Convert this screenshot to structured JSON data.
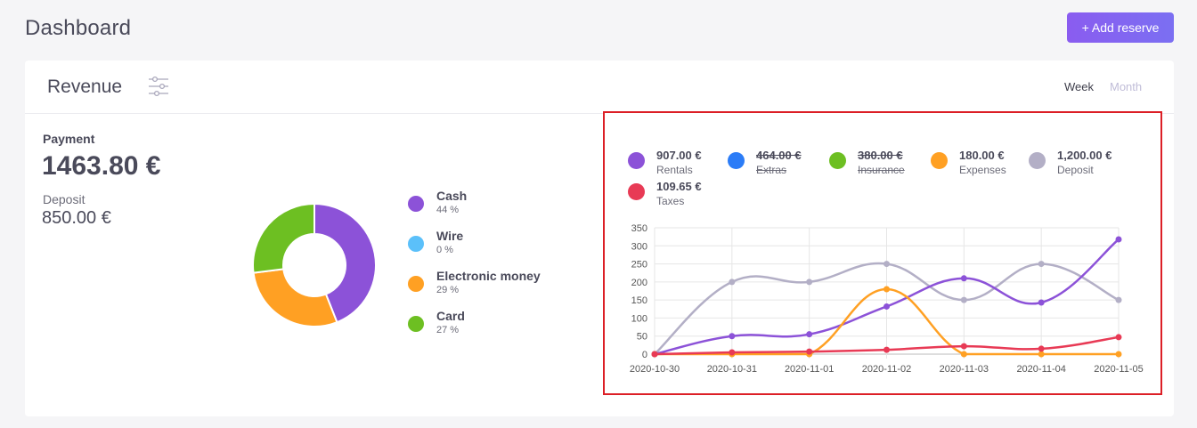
{
  "header": {
    "title": "Dashboard",
    "add_button": "+ Add reserve"
  },
  "revenue": {
    "title": "Revenue",
    "filter_icon": "sliders-icon",
    "periods": {
      "week": "Week",
      "month": "Month",
      "active": "Week"
    },
    "payment_label": "Payment",
    "payment_amount": "1463.80 €",
    "deposit_label": "Deposit",
    "deposit_amount": "850.00 €"
  },
  "payment_methods": {
    "items": [
      {
        "name": "Cash",
        "pct": "44 %",
        "value": 44,
        "color": "#8c52d8"
      },
      {
        "name": "Wire",
        "pct": "0 %",
        "value": 0,
        "color": "#5bc0fa"
      },
      {
        "name": "Electronic money",
        "pct": "29 %",
        "value": 29,
        "color": "#ffa023"
      },
      {
        "name": "Card",
        "pct": "27 %",
        "value": 27,
        "color": "#6dbf22"
      }
    ]
  },
  "chart_legend": [
    {
      "value": "907.00 €",
      "name": "Rentals",
      "color": "#8c52d8",
      "hidden": false
    },
    {
      "value": "464.00 €",
      "name": "Extras",
      "color": "#2b7cf7",
      "hidden": true
    },
    {
      "value": "380.00 €",
      "name": "Insurance",
      "color": "#6dbf22",
      "hidden": true
    },
    {
      "value": "180.00 €",
      "name": "Expenses",
      "color": "#ffa023",
      "hidden": false
    },
    {
      "value": "1,200.00 €",
      "name": "Deposit",
      "color": "#b3afc6",
      "hidden": false
    },
    {
      "value": "109.65 €",
      "name": "Taxes",
      "color": "#e83a55",
      "hidden": false
    }
  ],
  "chart_data": {
    "type": "line",
    "x": [
      "2020-10-30",
      "2020-10-31",
      "2020-11-01",
      "2020-11-02",
      "2020-11-03",
      "2020-11-04",
      "2020-11-05"
    ],
    "ylim": [
      0,
      350
    ],
    "yticks": [
      0,
      50,
      100,
      150,
      200,
      250,
      300,
      350
    ],
    "grid": true,
    "series": [
      {
        "name": "Deposit",
        "color": "#b3afc6",
        "values": [
          0,
          200,
          200,
          250,
          150,
          250,
          150
        ]
      },
      {
        "name": "Rentals",
        "color": "#8c52d8",
        "values": [
          0,
          50,
          55,
          132,
          210,
          143,
          318
        ]
      },
      {
        "name": "Expenses",
        "color": "#ffa023",
        "values": [
          0,
          0,
          0,
          180,
          0,
          0,
          0
        ]
      },
      {
        "name": "Taxes",
        "color": "#e83a55",
        "values": [
          0,
          5,
          7,
          12,
          22,
          15,
          47
        ]
      }
    ]
  }
}
